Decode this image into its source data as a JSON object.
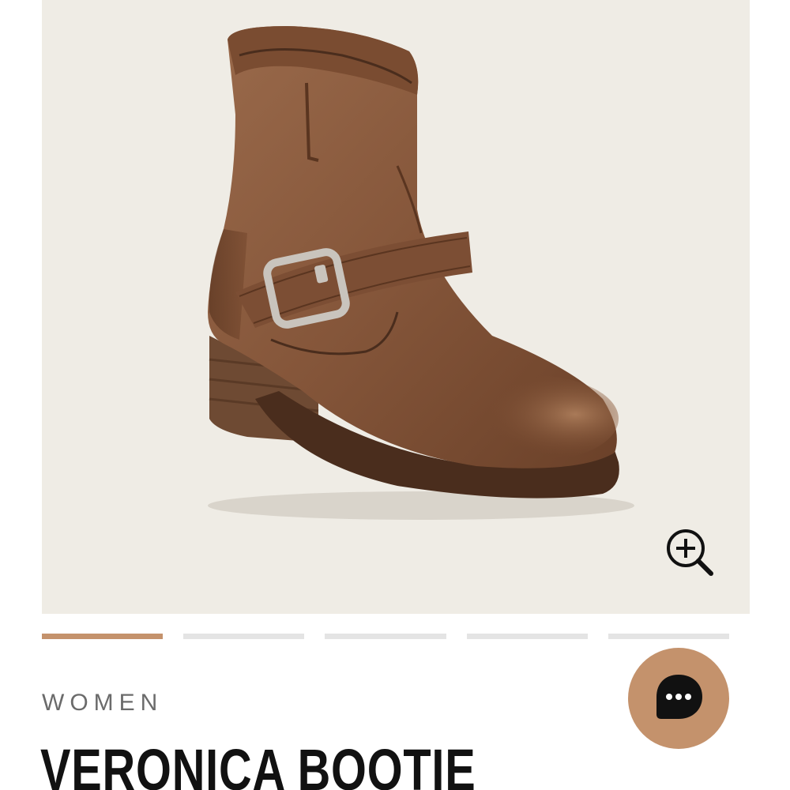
{
  "product": {
    "category": "WOMEN",
    "title": "VERONICA BOOTIE"
  },
  "gallery": {
    "image_count": 5,
    "active_index": 0,
    "image_description_icon": "boot-photo",
    "zoom_icon": "zoom-in-icon"
  },
  "chat": {
    "icon": "chat-bubble-icon"
  },
  "colors": {
    "accent": "#c4926c",
    "image_background": "#efece5",
    "pager_inactive": "#e4e4e4",
    "title": "#111111",
    "category": "#6b6b6b"
  }
}
